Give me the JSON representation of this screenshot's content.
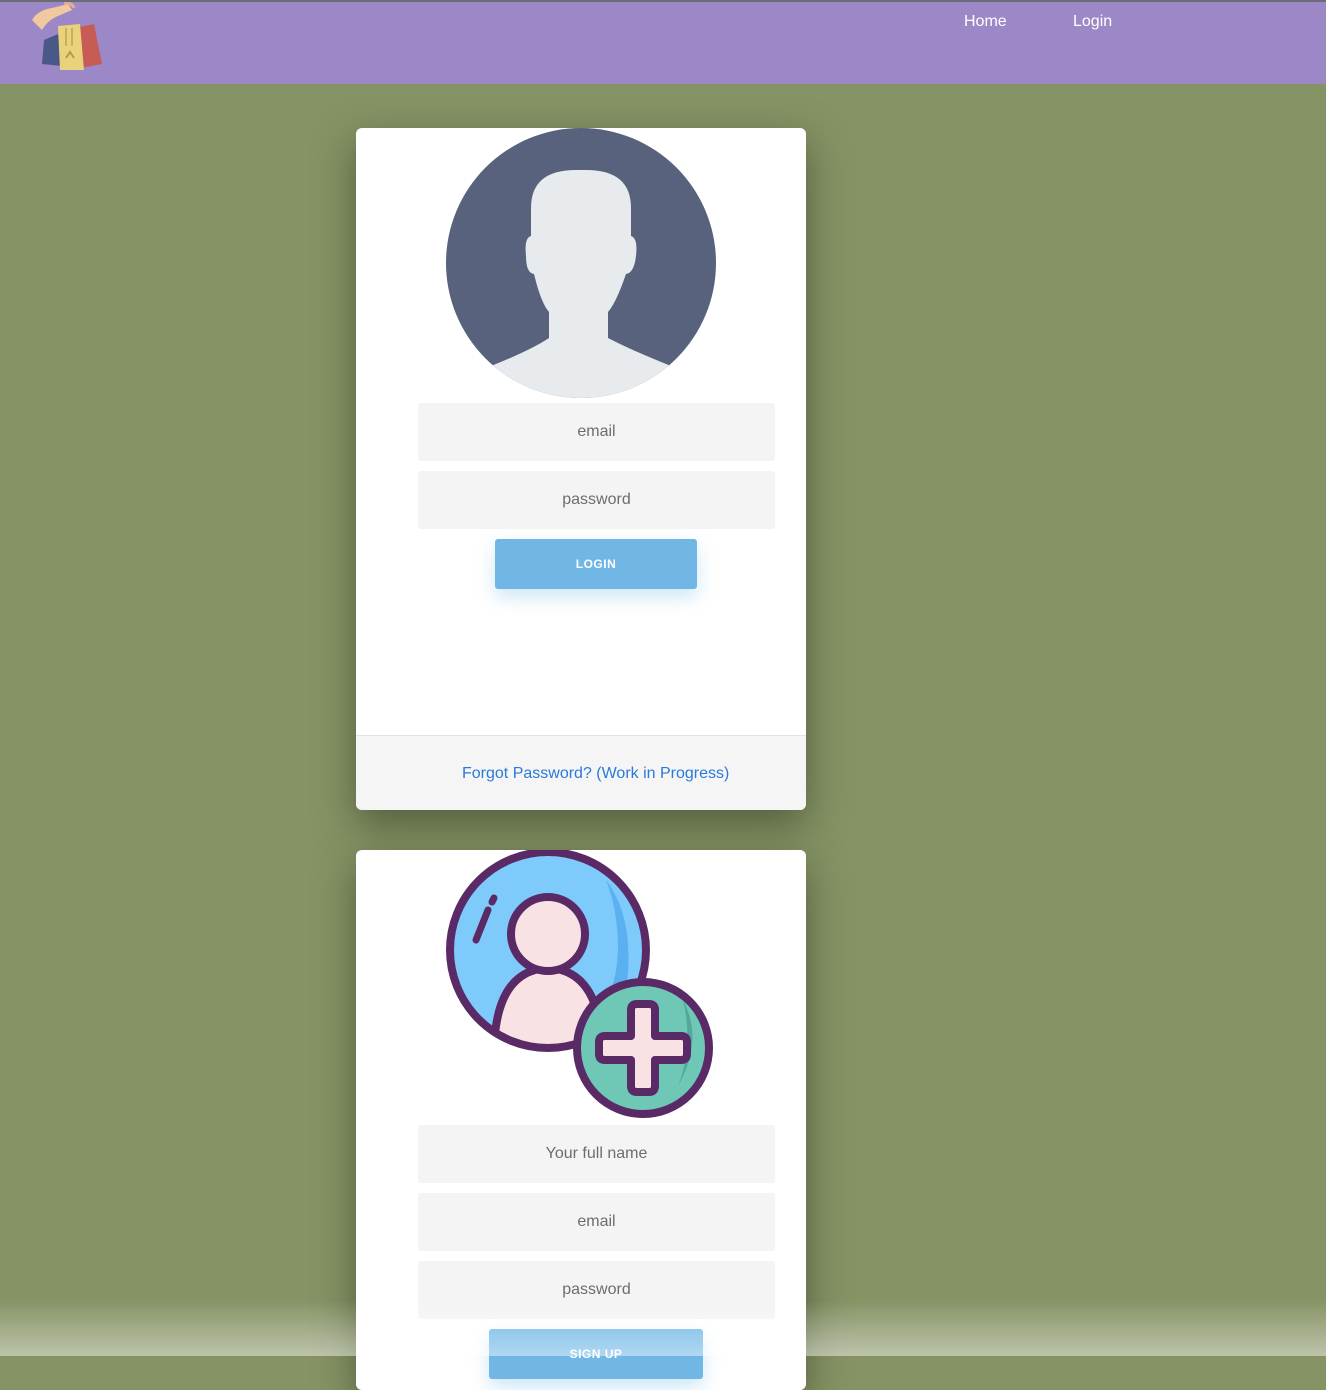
{
  "header": {
    "logo_icon": "shopping-bags-icon",
    "nav": [
      {
        "label": "Home"
      },
      {
        "label": "Login"
      }
    ],
    "background_color": "#9c88c6"
  },
  "login_card": {
    "avatar_icon": "user-silhouette-icon",
    "email_placeholder": "email",
    "password_placeholder": "password",
    "submit_label": "LOGIN",
    "forgot_link": "Forgot Password? (Work in Progress)"
  },
  "signup_card": {
    "avatar_icon": "add-user-icon",
    "name_placeholder": "Your full name",
    "email_placeholder": "email",
    "password_placeholder": "password",
    "submit_label": "SIGN UP"
  },
  "colors": {
    "page_background": "#869365",
    "button": "#70b7e6",
    "link": "#2a7ad8"
  }
}
